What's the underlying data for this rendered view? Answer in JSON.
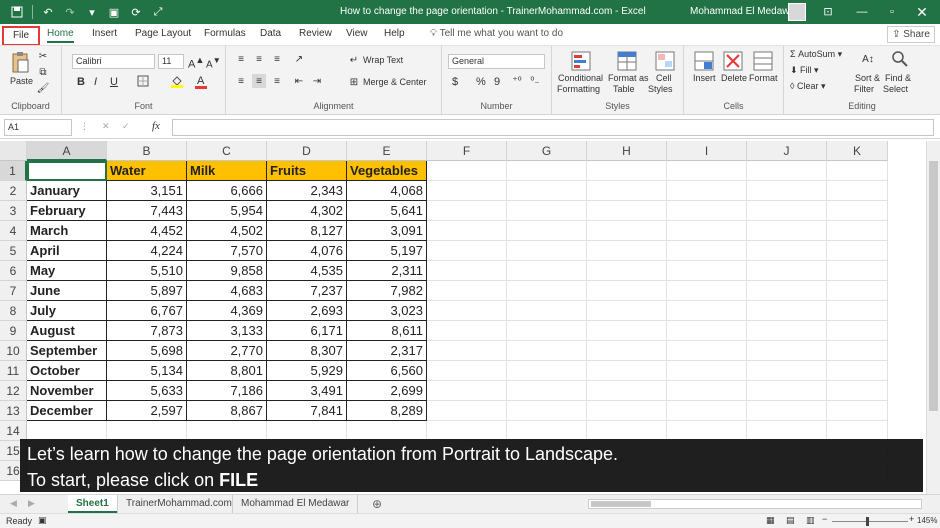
{
  "window": {
    "title": "How to change the page orientation - TrainerMohammad.com  -  Excel",
    "user": "Mohammad El Medawar"
  },
  "icons": {
    "save": "save-icon",
    "undo": "undo-icon",
    "redo": "redo-icon",
    "qat_more": "qat-customize-icon",
    "restore": "restore-icon",
    "minimize": "minimize-icon",
    "maximize": "maximize-icon",
    "close": "close-icon",
    "light": "lightbulb-icon",
    "share": "share-icon"
  },
  "tabs": [
    "File",
    "Home",
    "Insert",
    "Page Layout",
    "Formulas",
    "Data",
    "Review",
    "View",
    "Help"
  ],
  "tell_me": "Tell me what you want to do",
  "share": "Share",
  "ribbon": {
    "clipboard": {
      "label": "Clipboard",
      "paste": "Paste"
    },
    "font": {
      "label": "Font",
      "name": "Calibri",
      "size": "11",
      "bold": "B",
      "italic": "I",
      "underline": "U"
    },
    "alignment": {
      "label": "Alignment",
      "wrap": "Wrap Text",
      "merge": "Merge & Center"
    },
    "number": {
      "label": "Number",
      "format": "General",
      "currency": "$",
      "percent": "%",
      "comma": "9"
    },
    "styles": {
      "label": "Styles",
      "cond1": "Conditional",
      "cond2": "Formatting",
      "fmt1": "Format as",
      "fmt2": "Table",
      "cell1": "Cell",
      "cell2": "Styles"
    },
    "cells": {
      "label": "Cells",
      "insert": "Insert",
      "delete": "Delete",
      "format": "Format"
    },
    "editing": {
      "label": "Editing",
      "autosum": "AutoSum",
      "fill": "Fill",
      "clear": "Clear",
      "sort1": "Sort &",
      "sort2": "Filter",
      "find1": "Find &",
      "find2": "Select"
    }
  },
  "formula_bar": {
    "name_box": "A1",
    "fx": "fx",
    "value": ""
  },
  "columns": [
    "A",
    "B",
    "C",
    "D",
    "E",
    "F",
    "G",
    "H",
    "I",
    "J",
    "K"
  ],
  "rows": [
    "1",
    "2",
    "3",
    "4",
    "5",
    "6",
    "7",
    "8",
    "9",
    "10",
    "11",
    "12",
    "13",
    "14",
    "15",
    "16"
  ],
  "table": {
    "headers": [
      "",
      "Water",
      "Milk",
      "Fruits",
      "Vegetables"
    ],
    "data": [
      [
        "January",
        "3,151",
        "6,666",
        "2,343",
        "4,068"
      ],
      [
        "February",
        "7,443",
        "5,954",
        "4,302",
        "5,641"
      ],
      [
        "March",
        "4,452",
        "4,502",
        "8,127",
        "3,091"
      ],
      [
        "April",
        "4,224",
        "7,570",
        "4,076",
        "5,197"
      ],
      [
        "May",
        "5,510",
        "9,858",
        "4,535",
        "2,311"
      ],
      [
        "June",
        "5,897",
        "4,683",
        "7,237",
        "7,982"
      ],
      [
        "July",
        "6,767",
        "4,369",
        "2,693",
        "3,023"
      ],
      [
        "August",
        "7,873",
        "3,133",
        "6,171",
        "8,611"
      ],
      [
        "September",
        "5,698",
        "2,770",
        "8,307",
        "2,317"
      ],
      [
        "October",
        "5,134",
        "8,801",
        "5,929",
        "6,560"
      ],
      [
        "November",
        "5,633",
        "7,186",
        "3,491",
        "2,699"
      ],
      [
        "December",
        "2,597",
        "8,867",
        "7,841",
        "8,289"
      ]
    ]
  },
  "caption": {
    "line1": "Let’s learn how to change the page orientation from Portrait to Landscape.",
    "line2_prefix": "To start, please click on ",
    "line2_bold": "FILE"
  },
  "sheets": [
    "Sheet1",
    "TrainerMohammad.com",
    "Mohammad El Medawar"
  ],
  "status": {
    "ready": "Ready",
    "zoom": "145%"
  },
  "colors": {
    "accent": "#217346",
    "highlight": "#ffc000",
    "file_outline": "#e53935"
  }
}
